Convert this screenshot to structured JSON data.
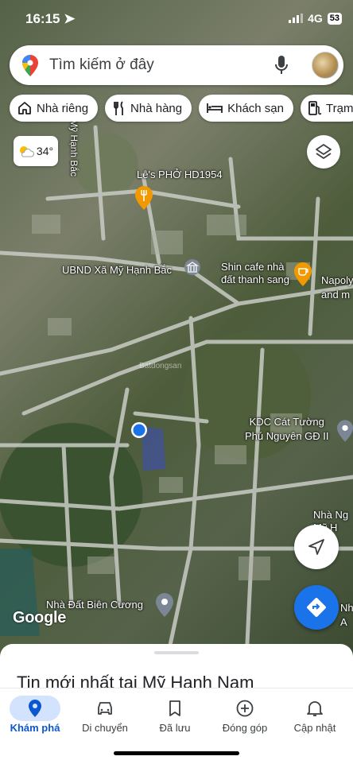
{
  "status": {
    "time": "16:15",
    "network": "4G",
    "battery": "53"
  },
  "search": {
    "placeholder": "Tìm kiếm ở đây"
  },
  "chips": [
    {
      "label": "Nhà riêng",
      "icon": "home-icon"
    },
    {
      "label": "Nhà hàng",
      "icon": "restaurant-icon"
    },
    {
      "label": "Khách sạn",
      "icon": "hotel-icon"
    },
    {
      "label": "Trạm",
      "icon": "gas-station-icon"
    }
  ],
  "weather": {
    "temp": "34°",
    "icon": "partly-sunny-icon"
  },
  "map": {
    "road_labels": [
      "Mỹ Hạnh Bắc"
    ],
    "places": [
      {
        "name": "Lê's PHỞ HD1954",
        "icon": "restaurant-pin-icon",
        "color": "#f29900"
      },
      {
        "name": "UBND Xã Mỹ Hạnh Bắc",
        "icon": "government-pin-icon",
        "color": "#7b8794"
      },
      {
        "name": "Shin cafe nhà\nđất thanh sang",
        "icon": "cafe-pin-icon",
        "color": "#f29900"
      },
      {
        "name": "Napoly\nand m",
        "icon": "",
        "color": ""
      },
      {
        "name": "KDC Cát Tường\nPhú Nguyên GĐ II",
        "icon": "place-pin-icon",
        "color": "#7b8794"
      },
      {
        "name": "Nhà Ng\nMỹ H",
        "icon": "",
        "color": ""
      },
      {
        "name": "Nhà Đất Biên Cương",
        "icon": "place-pin-icon",
        "color": "#7b8794"
      },
      {
        "name": "Nh\nA",
        "icon": "",
        "color": ""
      }
    ],
    "watermark": "Batdongsan",
    "logo": "Google"
  },
  "sheet": {
    "title": "Tin mới nhất tại Mỹ Hạnh Nam"
  },
  "nav": [
    {
      "label": "Khám phá",
      "icon": "explore-pin-icon",
      "active": true
    },
    {
      "label": "Di chuyển",
      "icon": "car-icon",
      "active": false
    },
    {
      "label": "Đã lưu",
      "icon": "bookmark-icon",
      "active": false
    },
    {
      "label": "Đóng góp",
      "icon": "add-circle-icon",
      "active": false
    },
    {
      "label": "Cập nhật",
      "icon": "bell-icon",
      "active": false
    }
  ],
  "colors": {
    "accent": "#1a73e8",
    "nav_active_bg": "#d3e3fd",
    "location_dot": "#1a73e8"
  }
}
